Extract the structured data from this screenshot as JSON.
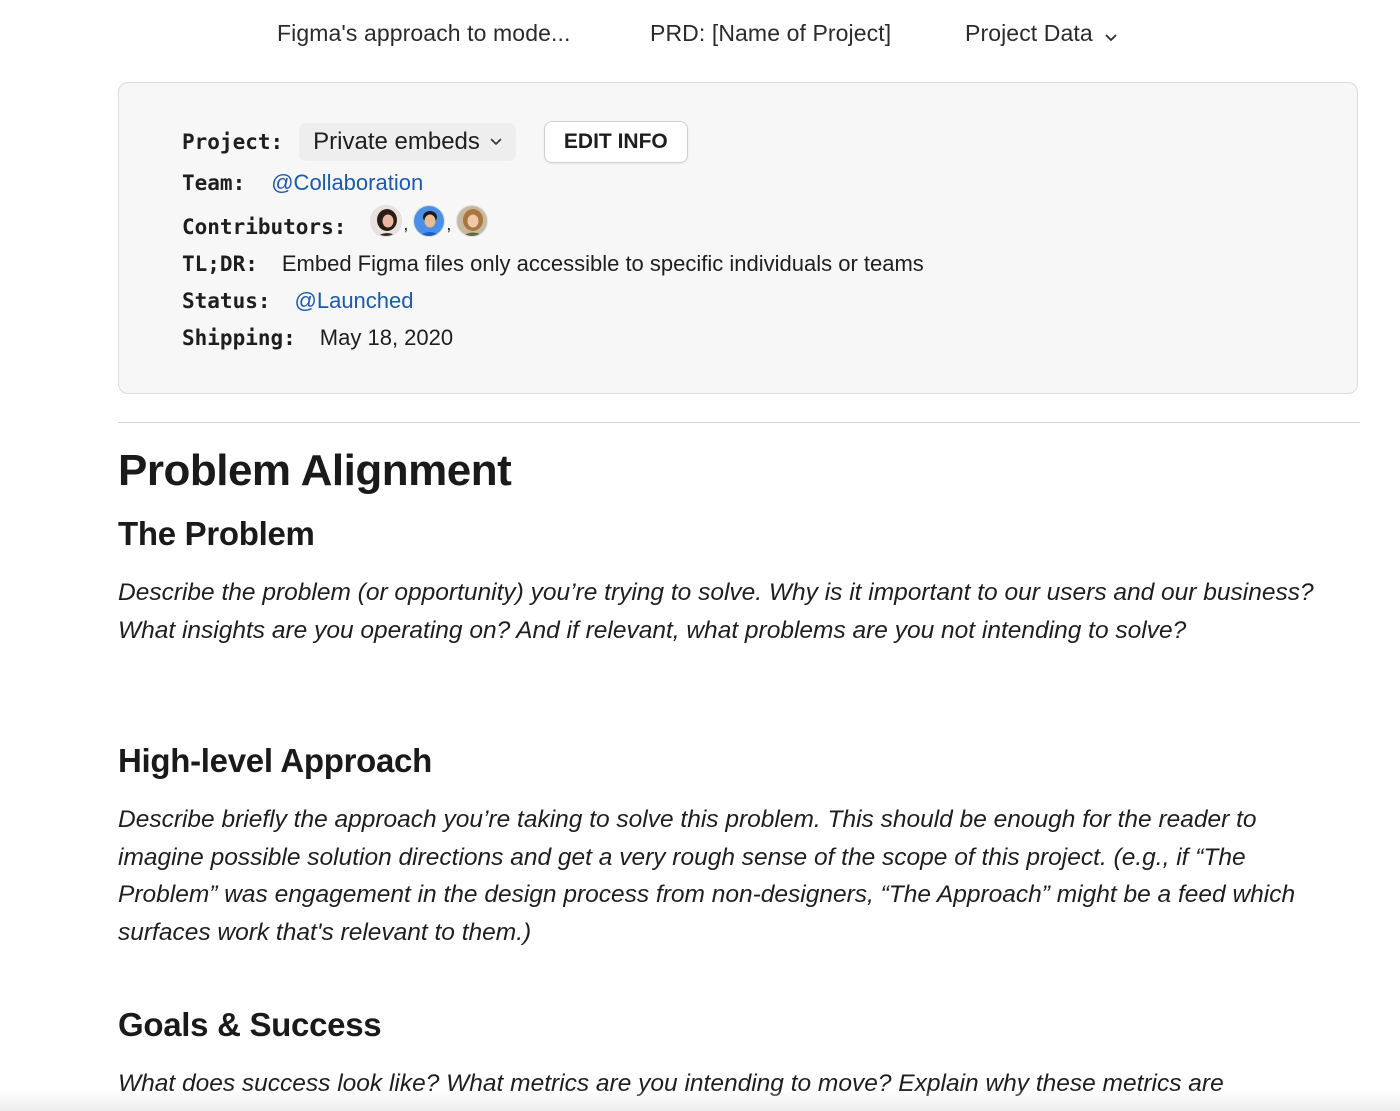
{
  "nav": {
    "items": [
      {
        "label": "Figma's approach to mode..."
      },
      {
        "label": "PRD: [Name of Project]"
      },
      {
        "label": "Project Data"
      }
    ]
  },
  "info": {
    "project_label": "Project:",
    "project_value": "Private embeds",
    "edit_button": "EDIT INFO",
    "team_label": "Team:",
    "team_value": "@Collaboration",
    "contributors_label": "Contributors:",
    "contributors_sep": ",",
    "tldr_label": "TL;DR:",
    "tldr_value": "Embed Figma files only accessible to specific individuals or teams",
    "status_label": "Status:",
    "status_value": "@Launched",
    "shipping_label": "Shipping:",
    "shipping_value": "May 18, 2020"
  },
  "doc": {
    "h1": "Problem Alignment",
    "sections": [
      {
        "heading": "The Problem",
        "body": "Describe the problem (or opportunity) you’re trying to solve. Why is it important to our users and our business? What insights are you operating on? And if relevant, what problems are you not intending to solve?"
      },
      {
        "heading": "High-level Approach",
        "body": "Describe briefly the approach you’re taking to solve this problem. This should be enough for the reader to imagine possible solution directions and get a very rough sense of the scope of this project. (e.g., if “The Problem” was engagement in the design process from non-designers, “The Approach” might be a feed which surfaces work that's relevant to them.)"
      },
      {
        "heading": "Goals & Success",
        "body": "What does success look like? What metrics are you intending to move? Explain why these metrics are"
      }
    ]
  },
  "colors": {
    "link": "#1a5ab0",
    "card_bg": "#f7f7f7",
    "text": "#1e1e1e"
  },
  "icons": {
    "nav_dropdown": "chevron-down-icon",
    "select_dropdown": "chevron-down-icon"
  }
}
